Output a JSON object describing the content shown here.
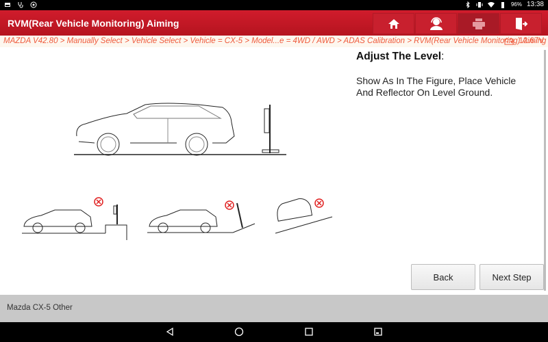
{
  "status_bar": {
    "left_icons": [
      "gallery-icon",
      "stethoscope-icon",
      "settings-gear-icon"
    ],
    "right_icons": [
      "bluetooth-icon",
      "vibrate-icon",
      "wifi-icon",
      "battery-icon"
    ],
    "battery": "96%",
    "time": "13:38"
  },
  "header": {
    "title": "RVM(Rear Vehicle Monitoring) Aiming",
    "buttons": [
      {
        "name": "home",
        "icon": "home-icon"
      },
      {
        "name": "support",
        "icon": "headset-user-icon"
      },
      {
        "name": "print",
        "icon": "printer-icon"
      },
      {
        "name": "exit",
        "icon": "exit-door-icon"
      }
    ],
    "accent": "#c8202e"
  },
  "breadcrumb": {
    "path": "MAZDA V42.80 > Manually Select > Vehicle Select > Vehicle = CX-5 > Model...e = 4WD / AWD > ADAS Calibration > RVM(Rear Vehicle Monitoring) Aiming",
    "voltage": "12.67V",
    "color": "#ef5a3c"
  },
  "instruction": {
    "heading": "Adjust The Level",
    "heading_colon": ":",
    "body": "Show As In The Figure, Place Vehicle And Reflector On Level Ground."
  },
  "figures": {
    "main": "car-on-level-ground-with-reflector",
    "wrong": [
      {
        "desc": "reflector-on-raised-platform",
        "mark": "X"
      },
      {
        "desc": "reflector-on-slope",
        "mark": "X"
      },
      {
        "desc": "car-tilted-on-slope",
        "mark": "X"
      }
    ]
  },
  "buttons": {
    "back": "Back",
    "next": "Next Step"
  },
  "footer": {
    "vehicle": "Mazda CX-5 Other"
  }
}
